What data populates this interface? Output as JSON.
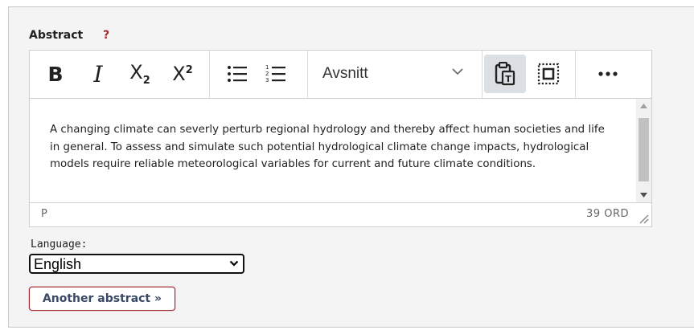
{
  "field": {
    "label": "Abstract",
    "required_marker": "?"
  },
  "toolbar": {
    "format_select_value": "Avsnitt",
    "buttons": [
      {
        "name": "bold",
        "icon": "bold-icon"
      },
      {
        "name": "italic",
        "icon": "italic-icon"
      },
      {
        "name": "subscript",
        "icon": "subscript-icon"
      },
      {
        "name": "superscript",
        "icon": "superscript-icon"
      },
      {
        "name": "bullet-list",
        "icon": "bullet-list-icon"
      },
      {
        "name": "numbered-list",
        "icon": "numbered-list-icon"
      },
      {
        "name": "paste-as-text",
        "icon": "clipboard-text-icon",
        "active": true
      },
      {
        "name": "select-all",
        "icon": "select-all-icon"
      },
      {
        "name": "more",
        "icon": "more-icon"
      }
    ]
  },
  "editor": {
    "content": "A changing climate can severly perturb regional hydrology and thereby affect human societies and life in general. To assess and simulate such potential hydrological climate change impacts, hydrological models require reliable meteorological variables for current and future climate conditions.",
    "path": "P",
    "word_count": "39 ORD"
  },
  "language": {
    "label": "Language:",
    "selected": "English"
  },
  "another_button_label": "Another abstract »",
  "colors": {
    "accent_red": "#a0282d",
    "panel_bg": "#f4f4f4",
    "active_button_bg": "#dcdfe3"
  }
}
